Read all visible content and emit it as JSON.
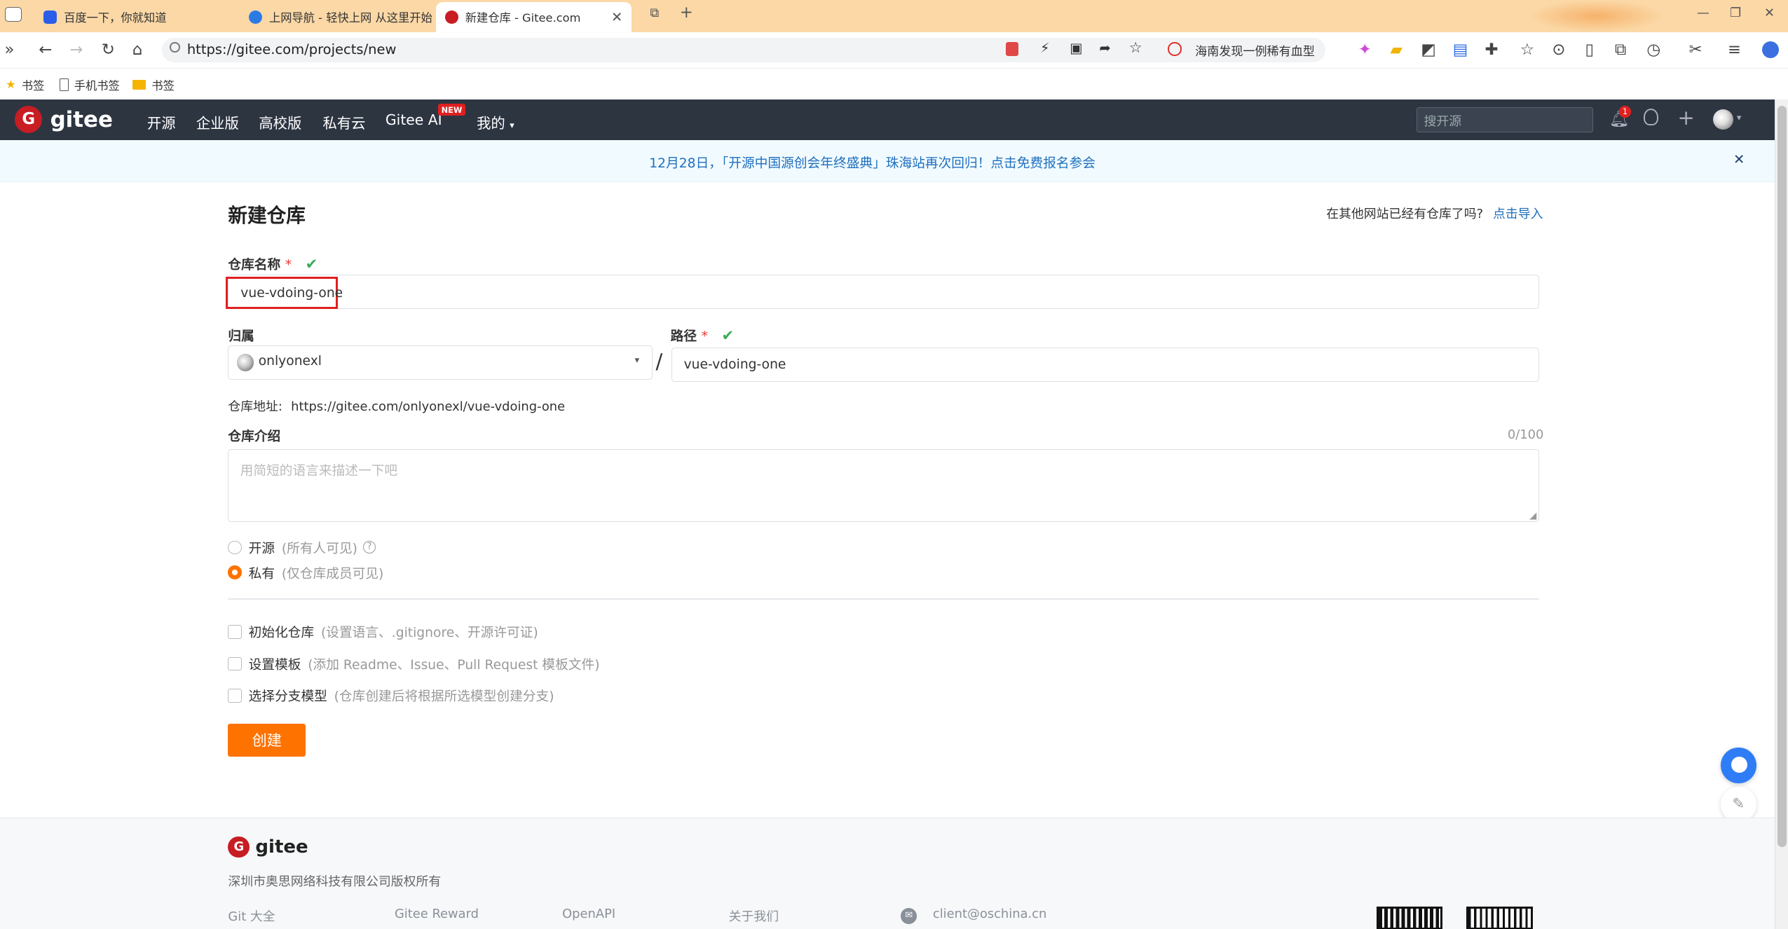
{
  "browser": {
    "tabs": [
      {
        "title": "百度一下，你就知道",
        "active": false
      },
      {
        "title": "上网导航 - 轻快上网 从这里开始",
        "active": false
      },
      {
        "title": "新建仓库 - Gitee.com",
        "active": true
      }
    ],
    "url": "https://gitee.com/projects/new",
    "search_suggestion": "海南发现一例稀有血型",
    "bookmarks": [
      "书签",
      "手机书签",
      "书签"
    ]
  },
  "header": {
    "logo_text": "gitee",
    "nav": [
      "开源",
      "企业版",
      "高校版",
      "私有云",
      "Gitee AI",
      "我的"
    ],
    "new_badge": "NEW",
    "search_placeholder": "搜开源",
    "notification_count": "1"
  },
  "banner": {
    "text": "12月28日，「开源中国源创会年终盛典」珠海站再次回归！点击免费报名参会",
    "close": "✕"
  },
  "form": {
    "title": "新建仓库",
    "import_hint": "在其他网站已经有仓库了吗?",
    "import_link": "点击导入",
    "repo_name_label": "仓库名称",
    "repo_name_value": "vue-vdoing-one",
    "owner_label": "归属",
    "owner_value": "onlyonexl",
    "path_label": "路径",
    "path_value": "vue-vdoing-one",
    "separator": "/",
    "address_label": "仓库地址:",
    "address_value": "https://gitee.com/onlyonexl/vue-vdoing-one",
    "intro_label": "仓库介绍",
    "intro_counter": "0/100",
    "intro_placeholder": "用简短的语言来描述一下吧",
    "visibility": [
      {
        "label": "开源",
        "hint": "(所有人可见)",
        "selected": false
      },
      {
        "label": "私有",
        "hint": "(仅仓库成员可见)",
        "selected": true
      }
    ],
    "options": [
      {
        "label": "初始化仓库",
        "hint": "(设置语言、.gitignore、开源许可证)"
      },
      {
        "label": "设置模板",
        "hint": "(添加 Readme、Issue、Pull Request 模板文件)"
      },
      {
        "label": "选择分支模型",
        "hint": "(仓库创建后将根据所选模型创建分支)"
      }
    ],
    "submit_label": "创建",
    "required_mark": "*"
  },
  "footer": {
    "logo_text": "gitee",
    "copyright": "深圳市奥思网络科技有限公司版权所有",
    "links": [
      "Git 大全",
      "Gitee Reward",
      "OpenAPI",
      "关于我们"
    ],
    "email": "client@oschina.cn"
  },
  "colors": {
    "accent": "#fe7300",
    "header_bg": "#2d3541",
    "link": "#1f6fbf",
    "valid": "#3bab5a",
    "highlight_box": "#e02020"
  }
}
